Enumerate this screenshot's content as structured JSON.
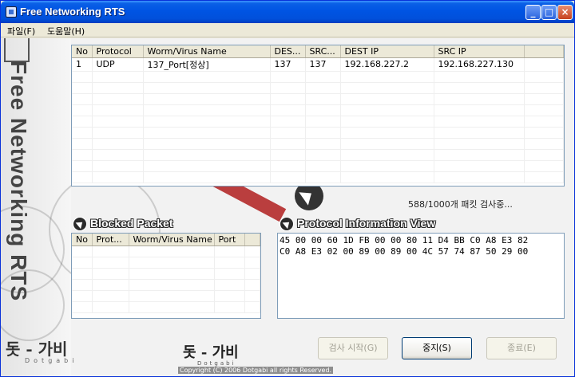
{
  "window": {
    "title": "Free Networking RTS",
    "buttons": {
      "minimize": "_",
      "maximize": "□",
      "close": "×"
    }
  },
  "menu": [
    {
      "label": "파일(F)"
    },
    {
      "label": "도움말(H)"
    }
  ],
  "branding": {
    "vertical": "Free Networking RTS",
    "korean": "돗 - 가비",
    "roman": "Dotgabi",
    "bottom_korean": "돗 - 가비",
    "bottom_roman": "Dotgabi",
    "copyright": "Copyright (C) 2006 Dotgabi all rights Reserved."
  },
  "packets": {
    "columns": [
      "No",
      "Protocol",
      "Worm/Virus Name",
      "DES...",
      "SRC...",
      "DEST IP",
      "SRC IP",
      ""
    ],
    "rows": [
      [
        "1",
        "UDP",
        "137_Port[정상]",
        "137",
        "137",
        "192.168.227.2",
        "192.168.227.130",
        ""
      ]
    ]
  },
  "status": "588/1000개 패킷 검사중...",
  "blocked": {
    "title": "Blocked Packet",
    "columns": [
      "No",
      "Prot...",
      "Worm/Virus Name",
      "Port",
      ""
    ]
  },
  "protocol_view": {
    "title": "Protocol Information View",
    "lines": [
      "45 00 00 60 1D FB 00 00 80 11 D4 BB C0 A8 E3 82",
      "C0 A8 E3 02 00 89 00 89 00 4C 57 74 87 50 29 00"
    ]
  },
  "buttons": {
    "start": "검사 시작(G)",
    "stop": "중지(S)",
    "quit": "종료(E)"
  }
}
